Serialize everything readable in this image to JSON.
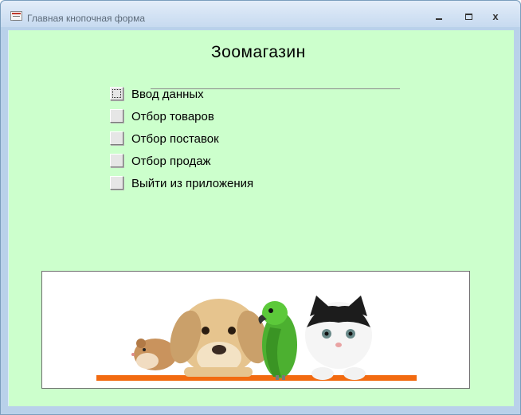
{
  "window": {
    "title": "Главная кнопочная форма",
    "icon": "access-form-icon",
    "controls": [
      "minimize-icon",
      "maximize-icon",
      "close-icon"
    ],
    "close_glyph": "x"
  },
  "form": {
    "title": "Зоомагазин",
    "background": "#ccffcc",
    "menu": [
      {
        "label": "Ввод данных",
        "focused": true
      },
      {
        "label": "Отбор товаров"
      },
      {
        "label": "Отбор поставок"
      },
      {
        "label": "Отбор продаж"
      },
      {
        "label": "Выйти из приложения"
      }
    ]
  },
  "banner": {
    "depicts": [
      "hamster",
      "puppy",
      "parrot",
      "kitten"
    ],
    "accent_color": "#f26a10"
  }
}
